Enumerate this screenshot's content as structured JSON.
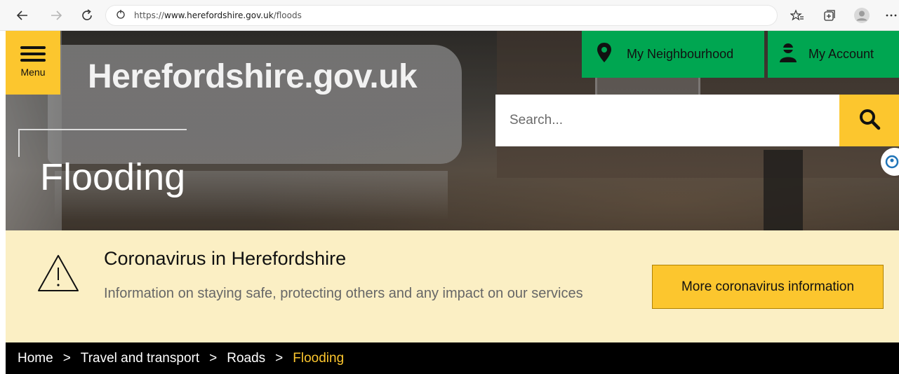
{
  "browser": {
    "url_prefix": "https://",
    "url_host": "www.herefordshire.gov.uk",
    "url_path": "/floods"
  },
  "site": {
    "menu_label": "Menu",
    "logo_text": "Herefordshire.gov.uk",
    "neighbourhood_label": "My Neighbourhood",
    "account_label": "My Account",
    "search_placeholder": "Search...",
    "accent_color": "#fcc62e",
    "green_color": "#00a651"
  },
  "page": {
    "title": "Flooding"
  },
  "alert": {
    "title": "Coronavirus in Herefordshire",
    "text": "Information on staying safe, protecting others and any impact on our services",
    "button_label": "More coronavirus information",
    "icon": "warning-triangle-icon"
  },
  "breadcrumb": {
    "separator": ">",
    "items": [
      "Home",
      "Travel and transport",
      "Roads",
      "Flooding"
    ]
  }
}
